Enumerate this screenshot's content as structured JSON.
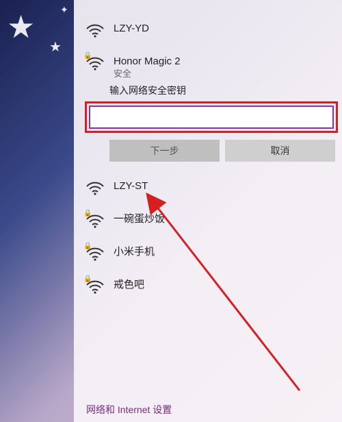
{
  "networks": [
    {
      "name": "LZY-YD",
      "secured": false
    },
    {
      "name": "Honor Magic 2",
      "secured": true,
      "sub": "安全",
      "expanded": true
    },
    {
      "name": "LZY-ST",
      "secured": false
    },
    {
      "name": "一碗蛋炒饭",
      "secured": true
    },
    {
      "name": "小米手机",
      "secured": true
    },
    {
      "name": "戒色吧",
      "secured": true
    }
  ],
  "connect": {
    "prompt": "输入网络安全密钥",
    "next": "下一步",
    "cancel": "取消",
    "value": ""
  },
  "footer": "网络和 Internet 设置"
}
